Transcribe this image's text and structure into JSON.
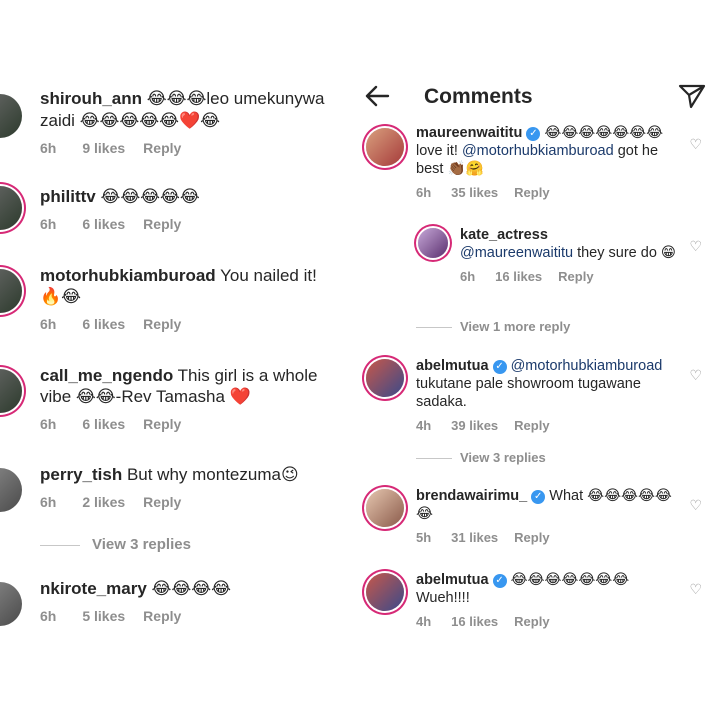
{
  "left": {
    "comments": [
      {
        "username": "shirouh_ann",
        "text_before": "",
        "emoji": "😂😂😂",
        "text": "leo umekunywa zaidi ",
        "emoji2": "😂😂😂😂😂❤️😂",
        "time": "6h",
        "likes": "9 likes",
        "reply": "Reply"
      },
      {
        "username": "philittv",
        "text_before": "",
        "emoji": "😂😂😂😂😂",
        "text": "",
        "emoji2": "",
        "time": "6h",
        "likes": "6 likes",
        "reply": "Reply"
      },
      {
        "username": "motorhubkiamburoad",
        "text_before": "",
        "emoji": "",
        "text": "You nailed it! ",
        "emoji2": "🔥😂",
        "time": "6h",
        "likes": "6 likes",
        "reply": "Reply"
      },
      {
        "username": "call_me_ngendo",
        "text_before": "",
        "emoji": "",
        "text": "This girl is a whole vibe ",
        "emoji2": "😂😂",
        "text_after": "-Rev Tamasha ",
        "emoji3": "❤️",
        "time": "6h",
        "likes": "6 likes",
        "reply": "Reply"
      },
      {
        "username": "perry_tish",
        "text_before": "",
        "emoji": "",
        "text": "But why montezuma",
        "emoji2": "😉",
        "time": "6h",
        "likes": "2 likes",
        "reply": "Reply"
      },
      {
        "username": "nkirote_mary",
        "text_before": "",
        "emoji": "😂😂😂😂",
        "text": "",
        "emoji2": "",
        "time": "6h",
        "likes": "5 likes",
        "reply": "Reply"
      }
    ],
    "view_replies": "View 3 replies"
  },
  "right": {
    "header": {
      "title": "Comments",
      "back_icon": "arrow-left-icon",
      "send_icon": "paper-plane-icon"
    },
    "comments": [
      {
        "username": "maureenwaititu",
        "verified": true,
        "emoji": "😂😂😂😂😂😂😂",
        "text_a": "love it! ",
        "mention": "@motorhubkiamburoad",
        "text_b": " got he best ",
        "emoji2": "👏🏾🤗",
        "time": "6h",
        "likes": "35 likes",
        "reply": "Reply"
      },
      {
        "username": "kate_actress",
        "verified": false,
        "mention": "@maureenwaititu",
        "text": " they sure do ",
        "emoji": "😁",
        "time": "6h",
        "likes": "16 likes",
        "reply": "Reply"
      },
      {
        "username": "abelmutua",
        "verified": true,
        "mention": "@motorhubkiamburoad",
        "text": "tukutane pale showroom tugawane sadaka.",
        "time": "4h",
        "likes": "39 likes",
        "reply": "Reply"
      },
      {
        "username": "brendawairimu_",
        "verified": true,
        "text": "What ",
        "emoji": "😂😂😂😂😂😂",
        "time": "5h",
        "likes": "31 likes",
        "reply": "Reply"
      },
      {
        "username": "abelmutua",
        "verified": true,
        "emoji": "😂😂😂😂😂😂😂",
        "text": "Wueh!!!!",
        "time": "4h",
        "likes": "16 likes",
        "reply": "Reply"
      }
    ],
    "view_more_reply": "View 1 more reply",
    "view_replies": "View 3 replies"
  },
  "colors": {
    "mention": "#1b3a6b",
    "meta": "#8e8e8e",
    "verified": "#3897f0",
    "ring": "#d62976"
  }
}
